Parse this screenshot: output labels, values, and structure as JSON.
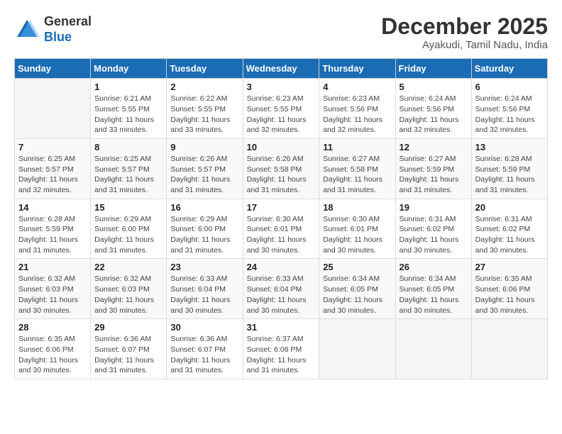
{
  "header": {
    "logo_general": "General",
    "logo_blue": "Blue",
    "month_title": "December 2025",
    "location": "Ayakudi, Tamil Nadu, India"
  },
  "days_of_week": [
    "Sunday",
    "Monday",
    "Tuesday",
    "Wednesday",
    "Thursday",
    "Friday",
    "Saturday"
  ],
  "weeks": [
    [
      {
        "day": "",
        "info": ""
      },
      {
        "day": "1",
        "info": "Sunrise: 6:21 AM\nSunset: 5:55 PM\nDaylight: 11 hours\nand 33 minutes."
      },
      {
        "day": "2",
        "info": "Sunrise: 6:22 AM\nSunset: 5:55 PM\nDaylight: 11 hours\nand 33 minutes."
      },
      {
        "day": "3",
        "info": "Sunrise: 6:23 AM\nSunset: 5:55 PM\nDaylight: 11 hours\nand 32 minutes."
      },
      {
        "day": "4",
        "info": "Sunrise: 6:23 AM\nSunset: 5:56 PM\nDaylight: 11 hours\nand 32 minutes."
      },
      {
        "day": "5",
        "info": "Sunrise: 6:24 AM\nSunset: 5:56 PM\nDaylight: 11 hours\nand 32 minutes."
      },
      {
        "day": "6",
        "info": "Sunrise: 6:24 AM\nSunset: 5:56 PM\nDaylight: 11 hours\nand 32 minutes."
      }
    ],
    [
      {
        "day": "7",
        "info": "Sunrise: 6:25 AM\nSunset: 5:57 PM\nDaylight: 11 hours\nand 32 minutes."
      },
      {
        "day": "8",
        "info": "Sunrise: 6:25 AM\nSunset: 5:57 PM\nDaylight: 11 hours\nand 31 minutes."
      },
      {
        "day": "9",
        "info": "Sunrise: 6:26 AM\nSunset: 5:57 PM\nDaylight: 11 hours\nand 31 minutes."
      },
      {
        "day": "10",
        "info": "Sunrise: 6:26 AM\nSunset: 5:58 PM\nDaylight: 11 hours\nand 31 minutes."
      },
      {
        "day": "11",
        "info": "Sunrise: 6:27 AM\nSunset: 5:58 PM\nDaylight: 11 hours\nand 31 minutes."
      },
      {
        "day": "12",
        "info": "Sunrise: 6:27 AM\nSunset: 5:59 PM\nDaylight: 11 hours\nand 31 minutes."
      },
      {
        "day": "13",
        "info": "Sunrise: 6:28 AM\nSunset: 5:59 PM\nDaylight: 11 hours\nand 31 minutes."
      }
    ],
    [
      {
        "day": "14",
        "info": "Sunrise: 6:28 AM\nSunset: 5:59 PM\nDaylight: 11 hours\nand 31 minutes."
      },
      {
        "day": "15",
        "info": "Sunrise: 6:29 AM\nSunset: 6:00 PM\nDaylight: 11 hours\nand 31 minutes."
      },
      {
        "day": "16",
        "info": "Sunrise: 6:29 AM\nSunset: 6:00 PM\nDaylight: 11 hours\nand 31 minutes."
      },
      {
        "day": "17",
        "info": "Sunrise: 6:30 AM\nSunset: 6:01 PM\nDaylight: 11 hours\nand 30 minutes."
      },
      {
        "day": "18",
        "info": "Sunrise: 6:30 AM\nSunset: 6:01 PM\nDaylight: 11 hours\nand 30 minutes."
      },
      {
        "day": "19",
        "info": "Sunrise: 6:31 AM\nSunset: 6:02 PM\nDaylight: 11 hours\nand 30 minutes."
      },
      {
        "day": "20",
        "info": "Sunrise: 6:31 AM\nSunset: 6:02 PM\nDaylight: 11 hours\nand 30 minutes."
      }
    ],
    [
      {
        "day": "21",
        "info": "Sunrise: 6:32 AM\nSunset: 6:03 PM\nDaylight: 11 hours\nand 30 minutes."
      },
      {
        "day": "22",
        "info": "Sunrise: 6:32 AM\nSunset: 6:03 PM\nDaylight: 11 hours\nand 30 minutes."
      },
      {
        "day": "23",
        "info": "Sunrise: 6:33 AM\nSunset: 6:04 PM\nDaylight: 11 hours\nand 30 minutes."
      },
      {
        "day": "24",
        "info": "Sunrise: 6:33 AM\nSunset: 6:04 PM\nDaylight: 11 hours\nand 30 minutes."
      },
      {
        "day": "25",
        "info": "Sunrise: 6:34 AM\nSunset: 6:05 PM\nDaylight: 11 hours\nand 30 minutes."
      },
      {
        "day": "26",
        "info": "Sunrise: 6:34 AM\nSunset: 6:05 PM\nDaylight: 11 hours\nand 30 minutes."
      },
      {
        "day": "27",
        "info": "Sunrise: 6:35 AM\nSunset: 6:06 PM\nDaylight: 11 hours\nand 30 minutes."
      }
    ],
    [
      {
        "day": "28",
        "info": "Sunrise: 6:35 AM\nSunset: 6:06 PM\nDaylight: 11 hours\nand 30 minutes."
      },
      {
        "day": "29",
        "info": "Sunrise: 6:36 AM\nSunset: 6:07 PM\nDaylight: 11 hours\nand 31 minutes."
      },
      {
        "day": "30",
        "info": "Sunrise: 6:36 AM\nSunset: 6:07 PM\nDaylight: 11 hours\nand 31 minutes."
      },
      {
        "day": "31",
        "info": "Sunrise: 6:37 AM\nSunset: 6:08 PM\nDaylight: 11 hours\nand 31 minutes."
      },
      {
        "day": "",
        "info": ""
      },
      {
        "day": "",
        "info": ""
      },
      {
        "day": "",
        "info": ""
      }
    ]
  ]
}
